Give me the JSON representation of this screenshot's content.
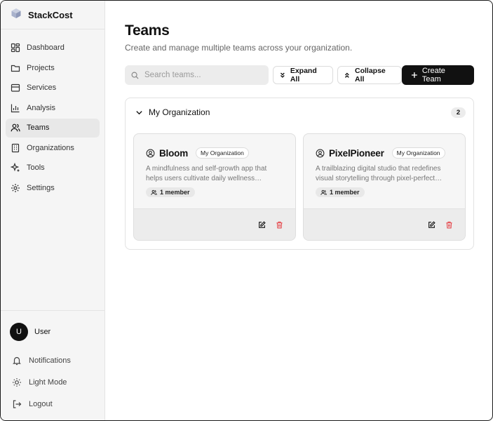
{
  "app": {
    "name": "StackCost"
  },
  "sidebar": {
    "items": [
      {
        "label": "Dashboard",
        "icon": "layout-grid-icon"
      },
      {
        "label": "Projects",
        "icon": "folder-icon"
      },
      {
        "label": "Services",
        "icon": "package-icon"
      },
      {
        "label": "Analysis",
        "icon": "bar-chart-icon"
      },
      {
        "label": "Teams",
        "icon": "users-icon",
        "active": true
      },
      {
        "label": "Organizations",
        "icon": "building-icon"
      },
      {
        "label": "Tools",
        "icon": "sparkles-icon"
      },
      {
        "label": "Settings",
        "icon": "gear-icon"
      }
    ],
    "user": {
      "initial": "U",
      "name": "User"
    },
    "bottom": {
      "notifications": "Notifications",
      "theme": "Light Mode",
      "logout": "Logout"
    }
  },
  "page": {
    "title": "Teams",
    "subtitle": "Create and manage multiple teams across your organization."
  },
  "toolbar": {
    "search_placeholder": "Search teams...",
    "expand_all": "Expand All",
    "collapse_all": "Collapse All",
    "create_team": "Create Team"
  },
  "organization": {
    "name": "My Organization",
    "count": "2",
    "teams": [
      {
        "name": "Bloom",
        "org_badge": "My Organization",
        "desc_line1": "A mindfulness and self-growth app that",
        "desc_line2": "helps users cultivate daily wellness…",
        "members": "1 member"
      },
      {
        "name": "PixelPioneer",
        "org_badge": "My Organization",
        "desc_line1": "A trailblazing digital studio that redefines",
        "desc_line2": "visual storytelling through pixel-perfect…",
        "members": "1 member"
      }
    ]
  },
  "colors": {
    "primary": "#111111",
    "delete": "#e5484d",
    "sidebar_bg": "#f5f5f5"
  }
}
